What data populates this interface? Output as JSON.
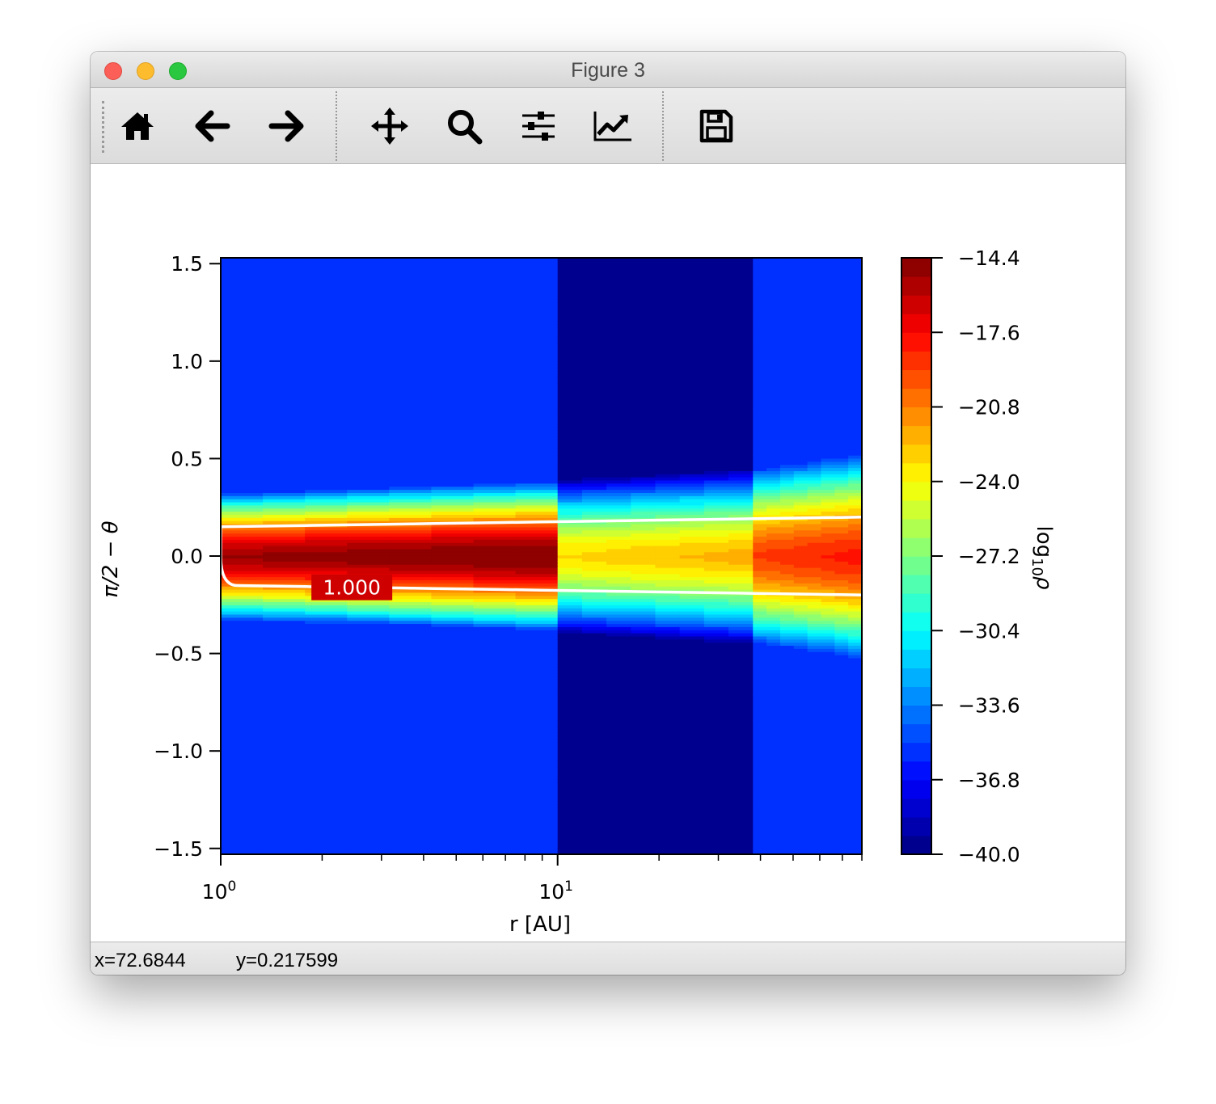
{
  "window": {
    "title": "Figure 3"
  },
  "toolbar": {
    "buttons": [
      {
        "name": "home",
        "icon": "home-icon"
      },
      {
        "name": "back",
        "icon": "arrow-left-icon"
      },
      {
        "name": "forward",
        "icon": "arrow-right-icon"
      },
      {
        "name": "pan",
        "icon": "move-icon"
      },
      {
        "name": "zoom",
        "icon": "magnifier-icon"
      },
      {
        "name": "subplots",
        "icon": "sliders-icon"
      },
      {
        "name": "edit-curves",
        "icon": "line-chart-icon"
      },
      {
        "name": "save",
        "icon": "floppy-disk-icon"
      }
    ]
  },
  "status": {
    "x_text": "x=72.6844",
    "y_text": "y=0.217599"
  },
  "colors": {
    "titlebar": "#e3e3e3",
    "close": "#fc5f57",
    "minimize": "#fdbc2e",
    "maximize": "#29c840"
  },
  "chart_data": {
    "type": "heatmap",
    "subtype": "filled-contour",
    "colormap": "jet",
    "xlabel": "r [AU]",
    "ylabel": "π/2 − θ",
    "xscale": "log",
    "xlim": [
      1,
      80
    ],
    "ylim": [
      -1.53,
      1.53
    ],
    "xticks": [
      {
        "value": 1,
        "base": "10",
        "exp": "0"
      },
      {
        "value": 10,
        "base": "10",
        "exp": "1"
      }
    ],
    "yticks": [
      "1.5",
      "1.0",
      "0.5",
      "0.0",
      "−0.5",
      "−1.0",
      "−1.5"
    ],
    "ytick_values": [
      1.5,
      1.0,
      0.5,
      0.0,
      -0.5,
      -1.0,
      -1.5
    ],
    "colorbar": {
      "label_base": "log",
      "label_sub": "10",
      "label_sym": "ρ",
      "range": [
        -40.0,
        -14.4
      ],
      "levels": 32,
      "ticks": [
        "−14.4",
        "−17.6",
        "−20.8",
        "−24.0",
        "−27.2",
        "−30.4",
        "−33.6",
        "−36.8",
        "−40.0"
      ],
      "tick_values": [
        -14.4,
        -17.6,
        -20.8,
        -24.0,
        -27.2,
        -30.4,
        -33.6,
        -36.8,
        -40.0
      ]
    },
    "regions": [
      {
        "r_range": [
          1,
          10
        ],
        "background": -35.2,
        "midplane_peak": -15.2,
        "scale_height_at_start": 0.32,
        "scale_height_at_end": 0.38
      },
      {
        "r_range": [
          10,
          38
        ],
        "background": -40.0,
        "midplane_peak": -23.2,
        "scale_height_at_start": 0.4,
        "scale_height_at_end": 0.46
      },
      {
        "r_range": [
          38,
          80
        ],
        "background": -35.2,
        "midplane_peak": -19.2,
        "scale_height_at_start": 0.44,
        "scale_height_at_end": 0.52
      }
    ],
    "contour": {
      "level_label": "1.000",
      "color": "#ffffff",
      "half_width_at_r1": 0.15,
      "half_width_at_r80": 0.2
    }
  }
}
